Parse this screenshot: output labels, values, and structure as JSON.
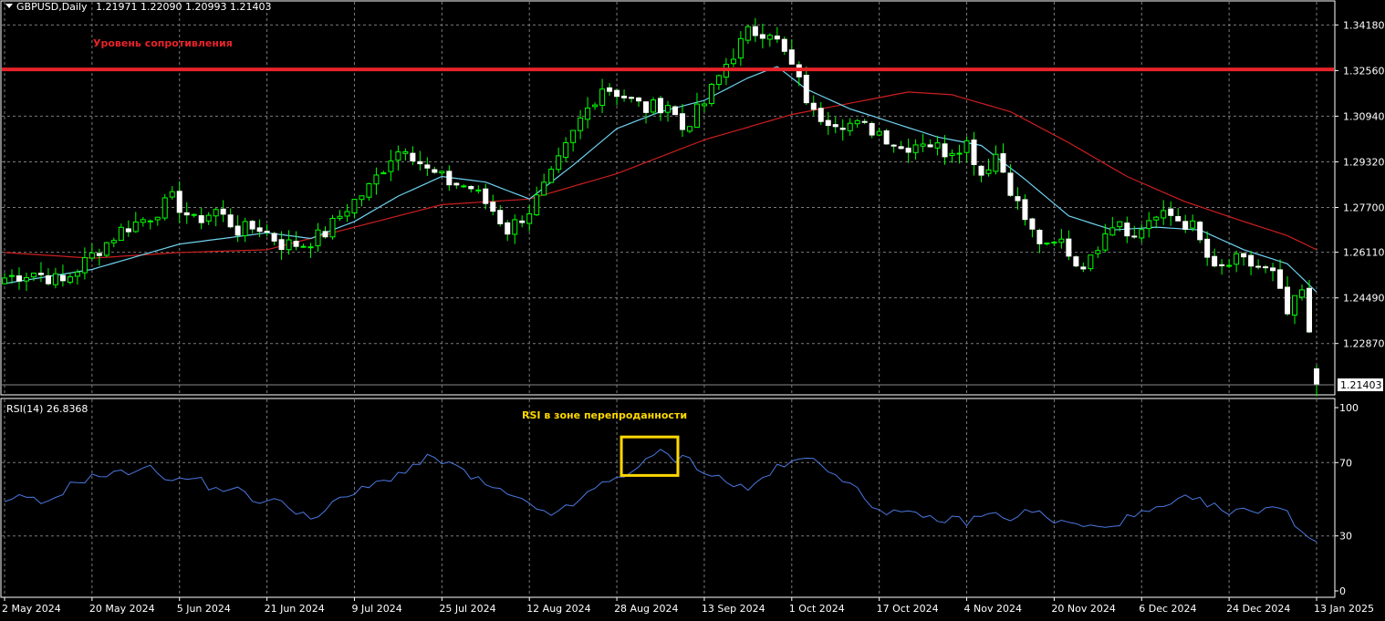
{
  "chart_data": [
    {
      "type": "candlestick",
      "title": "GBPUSD,Daily",
      "ohlc_header": "1.21971 1.22090 1.20993 1.21403",
      "current_price_label": "1.21403",
      "current_price": 1.21403,
      "ylim": [
        1.2108,
        1.35
      ],
      "y_ticks": [
        1.3418,
        1.3256,
        1.3094,
        1.2932,
        1.277,
        1.2611,
        1.2449,
        1.2287
      ],
      "y_tick_labels": [
        "1.34180",
        "1.32560",
        "1.30940",
        "1.29320",
        "1.27700",
        "1.26110",
        "1.24490",
        "1.22870"
      ],
      "x_tick_labels": [
        "2 May 2024",
        "20 May 2024",
        "5 Jun 2024",
        "21 Jun 2024",
        "9 Jul 2024",
        "25 Jul 2024",
        "12 Aug 2024",
        "28 Aug 2024",
        "13 Sep 2024",
        "1 Oct 2024",
        "17 Oct 2024",
        "4 Nov 2024",
        "20 Nov 2024",
        "6 Dec 2024",
        "24 Dec 2024",
        "13 Jan 2025"
      ],
      "x_tick_bar_index": [
        0,
        12,
        24,
        36,
        48,
        60,
        72,
        84,
        96,
        108,
        120,
        132,
        144,
        156,
        168,
        180
      ],
      "bar_count": 181,
      "close_anchors": [
        [
          0,
          1.252
        ],
        [
          4,
          1.254
        ],
        [
          8,
          1.2505
        ],
        [
          12,
          1.26
        ],
        [
          16,
          1.269
        ],
        [
          20,
          1.274
        ],
        [
          23,
          1.28
        ],
        [
          26,
          1.272
        ],
        [
          29,
          1.276
        ],
        [
          32,
          1.269
        ],
        [
          35,
          1.27
        ],
        [
          38,
          1.264
        ],
        [
          41,
          1.264
        ],
        [
          44,
          1.268
        ],
        [
          47,
          1.277
        ],
        [
          50,
          1.284
        ],
        [
          53,
          1.295
        ],
        [
          55,
          1.299
        ],
        [
          58,
          1.29
        ],
        [
          61,
          1.286
        ],
        [
          64,
          1.284
        ],
        [
          67,
          1.276
        ],
        [
          69,
          1.269
        ],
        [
          72,
          1.276
        ],
        [
          75,
          1.288
        ],
        [
          79,
          1.308
        ],
        [
          82,
          1.32
        ],
        [
          84,
          1.318
        ],
        [
          88,
          1.312
        ],
        [
          91,
          1.314
        ],
        [
          93,
          1.305
        ],
        [
          96,
          1.314
        ],
        [
          99,
          1.328
        ],
        [
          102,
          1.339
        ],
        [
          105,
          1.34
        ],
        [
          108,
          1.327
        ],
        [
          111,
          1.31
        ],
        [
          114,
          1.308
        ],
        [
          117,
          1.306
        ],
        [
          120,
          1.304
        ],
        [
          123,
          1.298
        ],
        [
          126,
          1.301
        ],
        [
          129,
          1.297
        ],
        [
          132,
          1.3
        ],
        [
          134,
          1.289
        ],
        [
          136,
          1.296
        ],
        [
          139,
          1.278
        ],
        [
          141,
          1.268
        ],
        [
          143,
          1.262
        ],
        [
          145,
          1.265
        ],
        [
          147,
          1.257
        ],
        [
          149,
          1.258
        ],
        [
          151,
          1.27
        ],
        [
          153,
          1.273
        ],
        [
          155,
          1.266
        ],
        [
          157,
          1.273
        ],
        [
          160,
          1.274
        ],
        [
          163,
          1.27
        ],
        [
          166,
          1.254
        ],
        [
          169,
          1.258
        ],
        [
          172,
          1.256
        ],
        [
          174,
          1.253
        ],
        [
          176,
          1.239
        ],
        [
          178,
          1.247
        ],
        [
          179,
          1.231
        ],
        [
          180,
          1.21403
        ]
      ],
      "ma_fast": {
        "color": "#6fd3f0",
        "anchors": [
          [
            0,
            1.25
          ],
          [
            12,
            1.255
          ],
          [
            24,
            1.264
          ],
          [
            36,
            1.268
          ],
          [
            42,
            1.266
          ],
          [
            48,
            1.272
          ],
          [
            54,
            1.281
          ],
          [
            60,
            1.288
          ],
          [
            66,
            1.286
          ],
          [
            72,
            1.28
          ],
          [
            78,
            1.292
          ],
          [
            84,
            1.305
          ],
          [
            90,
            1.311
          ],
          [
            96,
            1.315
          ],
          [
            102,
            1.323
          ],
          [
            106,
            1.327
          ],
          [
            110,
            1.319
          ],
          [
            116,
            1.312
          ],
          [
            122,
            1.307
          ],
          [
            128,
            1.302
          ],
          [
            134,
            1.299
          ],
          [
            140,
            1.287
          ],
          [
            146,
            1.274
          ],
          [
            152,
            1.269
          ],
          [
            158,
            1.27
          ],
          [
            164,
            1.269
          ],
          [
            170,
            1.262
          ],
          [
            176,
            1.257
          ],
          [
            180,
            1.247
          ]
        ]
      },
      "ma_slow": {
        "color": "#cc1e1e",
        "anchors": [
          [
            0,
            1.261
          ],
          [
            12,
            1.259
          ],
          [
            24,
            1.261
          ],
          [
            36,
            1.262
          ],
          [
            48,
            1.27
          ],
          [
            60,
            1.278
          ],
          [
            72,
            1.28
          ],
          [
            84,
            1.289
          ],
          [
            96,
            1.301
          ],
          [
            108,
            1.31
          ],
          [
            116,
            1.314
          ],
          [
            124,
            1.318
          ],
          [
            130,
            1.317
          ],
          [
            138,
            1.311
          ],
          [
            146,
            1.3
          ],
          [
            154,
            1.288
          ],
          [
            162,
            1.279
          ],
          [
            170,
            1.272
          ],
          [
            176,
            1.267
          ],
          [
            180,
            1.262
          ]
        ]
      },
      "resistance_level": {
        "price": 1.326,
        "color": "#e8232a",
        "label": "Уровень сопротивления"
      }
    },
    {
      "type": "line",
      "title": "RSI(14) 26.8368",
      "ylim": [
        0,
        100
      ],
      "y_ticks": [
        100,
        70,
        30,
        0
      ],
      "y_tick_labels": [
        "100",
        "70",
        "30",
        "0"
      ],
      "line_color": "#4a78e0",
      "anchors": [
        [
          0,
          47
        ],
        [
          3,
          52
        ],
        [
          5,
          46
        ],
        [
          7,
          52
        ],
        [
          10,
          60
        ],
        [
          13,
          63
        ],
        [
          16,
          64
        ],
        [
          19,
          68
        ],
        [
          22,
          63
        ],
        [
          24,
          60
        ],
        [
          26,
          62
        ],
        [
          29,
          55
        ],
        [
          31,
          57
        ],
        [
          34,
          50
        ],
        [
          37,
          49
        ],
        [
          40,
          44
        ],
        [
          43,
          40
        ],
        [
          46,
          50
        ],
        [
          49,
          55
        ],
        [
          52,
          60
        ],
        [
          55,
          66
        ],
        [
          58,
          72
        ],
        [
          61,
          70
        ],
        [
          64,
          62
        ],
        [
          67,
          56
        ],
        [
          70,
          50
        ],
        [
          73,
          45
        ],
        [
          76,
          42
        ],
        [
          79,
          50
        ],
        [
          82,
          58
        ],
        [
          85,
          64
        ],
        [
          88,
          70
        ],
        [
          90,
          76
        ],
        [
          92,
          72
        ],
        [
          94,
          72
        ],
        [
          96,
          65
        ],
        [
          99,
          60
        ],
        [
          102,
          55
        ],
        [
          105,
          65
        ],
        [
          108,
          70
        ],
        [
          111,
          72
        ],
        [
          114,
          65
        ],
        [
          116,
          58
        ],
        [
          118,
          50
        ],
        [
          120,
          45
        ],
        [
          123,
          42
        ],
        [
          126,
          40
        ],
        [
          129,
          39
        ],
        [
          132,
          38
        ],
        [
          135,
          42
        ],
        [
          138,
          40
        ],
        [
          141,
          44
        ],
        [
          144,
          38
        ],
        [
          147,
          36
        ],
        [
          150,
          34
        ],
        [
          153,
          38
        ],
        [
          156,
          42
        ],
        [
          159,
          45
        ],
        [
          162,
          50
        ],
        [
          165,
          48
        ],
        [
          168,
          42
        ],
        [
          171,
          44
        ],
        [
          174,
          46
        ],
        [
          176,
          42
        ],
        [
          178,
          33
        ],
        [
          180,
          26.8368
        ]
      ],
      "oversold_box_bar_range": [
        85,
        92
      ],
      "annotation": "RSI в зоне перепроданности"
    }
  ]
}
